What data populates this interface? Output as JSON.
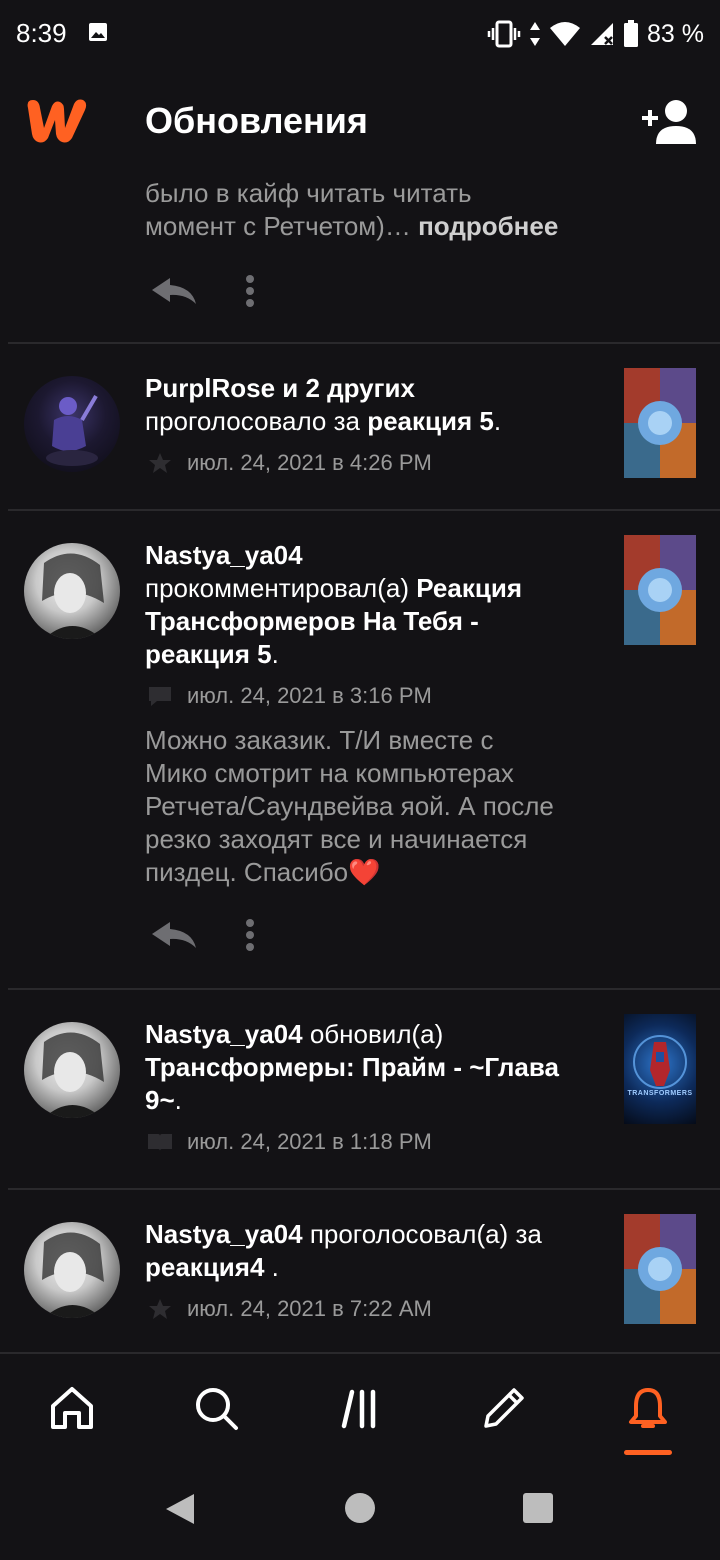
{
  "status_bar": {
    "time": "8:39",
    "battery": "83 %"
  },
  "app_bar": {
    "title": "Обновления"
  },
  "feed": {
    "partial_item": {
      "line1": "было в кайф читать читать",
      "line2": "момент с Ретчетом)…",
      "more": "подробнее"
    },
    "item1": {
      "user": "PurplRose и 2 других",
      "action": "проголосовало за",
      "target": "реакция 5",
      "period": ".",
      "timestamp": "июл. 24, 2021 в 4:26 PM",
      "meta_icon": "star-icon"
    },
    "item2": {
      "user": "Nastya_ya04",
      "action": "прокомментировал(а)",
      "target_line1": "Реакция",
      "target_line2": "Трансформеров На Тебя -",
      "target_line3": "реакция 5",
      "period": ".",
      "timestamp": "июл. 24, 2021 в 3:16 PM",
      "meta_icon": "comment-icon",
      "comment_lines": [
        "Можно заказик. Т/И вместе с",
        "Мико смотрит на компьютерах",
        "Ретчета/Саундвейва яой. А после",
        "резко заходят все и начинается",
        "пиздец. Спасибо"
      ],
      "emoji": "❤️"
    },
    "item3": {
      "user": "Nastya_ya04",
      "action": "обновил(а)",
      "target_line1": "Трансформеры: Прайм - ~Глава",
      "target_line2": "9~",
      "period": ".",
      "timestamp": "июл. 24, 2021 в 1:18 PM",
      "meta_icon": "book-icon",
      "thumb_text": "TRANSFORMERS"
    },
    "item4": {
      "user": "Nastya_ya04",
      "action": "проголосовал(а) за",
      "target": "реакция4",
      "period": " .",
      "timestamp": "июл. 24, 2021 в 7:22 AM",
      "meta_icon": "star-icon"
    }
  },
  "bottom_nav": {
    "items": [
      "home-icon",
      "search-icon",
      "library-icon",
      "write-icon",
      "notifications-icon"
    ],
    "active": "notifications-icon"
  },
  "colors": {
    "accent": "#ff6122",
    "background": "#131215",
    "muted_text": "#9a9a9a"
  }
}
